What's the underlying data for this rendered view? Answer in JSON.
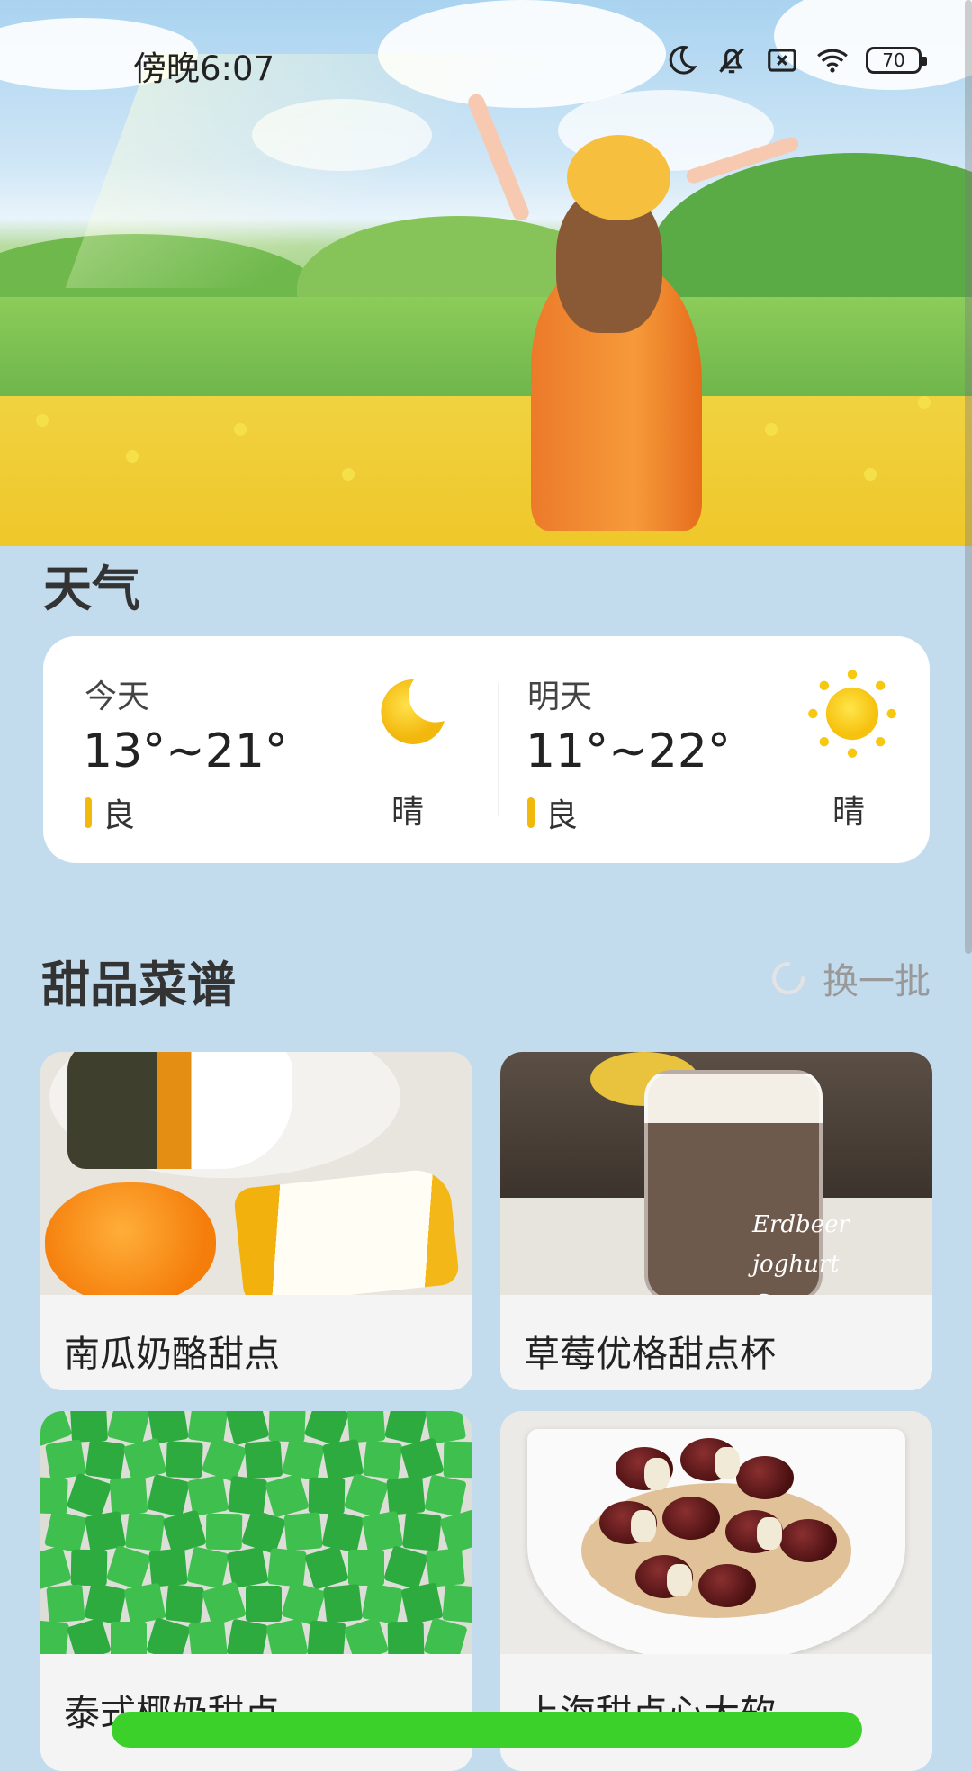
{
  "status_bar": {
    "time": "傍晚6:07",
    "battery": "70",
    "icons": [
      "moon-icon",
      "bell-off-icon",
      "sim-off-icon",
      "wifi-icon",
      "battery-icon"
    ]
  },
  "weather": {
    "title": "天气",
    "today": {
      "label": "今天",
      "temp": "13°~21°",
      "aq": "良",
      "cond": "晴",
      "icon": "moon-icon"
    },
    "tomorrow": {
      "label": "明天",
      "temp": "11°~22°",
      "aq": "良",
      "cond": "晴",
      "icon": "sun-icon"
    },
    "aq_color": "#f1b90b"
  },
  "dessert": {
    "title": "甜品菜谱",
    "refresh_label": "换一批",
    "items": [
      {
        "name": "南瓜奶酪甜点"
      },
      {
        "name": "草莓优格甜点杯",
        "image_text": [
          "Erdbeer joghurt",
          "Creme"
        ]
      },
      {
        "name": "泰式椰奶甜点"
      },
      {
        "name": "上海甜点心大软"
      }
    ]
  },
  "colors": {
    "background": "#c3dced",
    "accent_green": "#3bd12a",
    "card": "#ffffff"
  }
}
